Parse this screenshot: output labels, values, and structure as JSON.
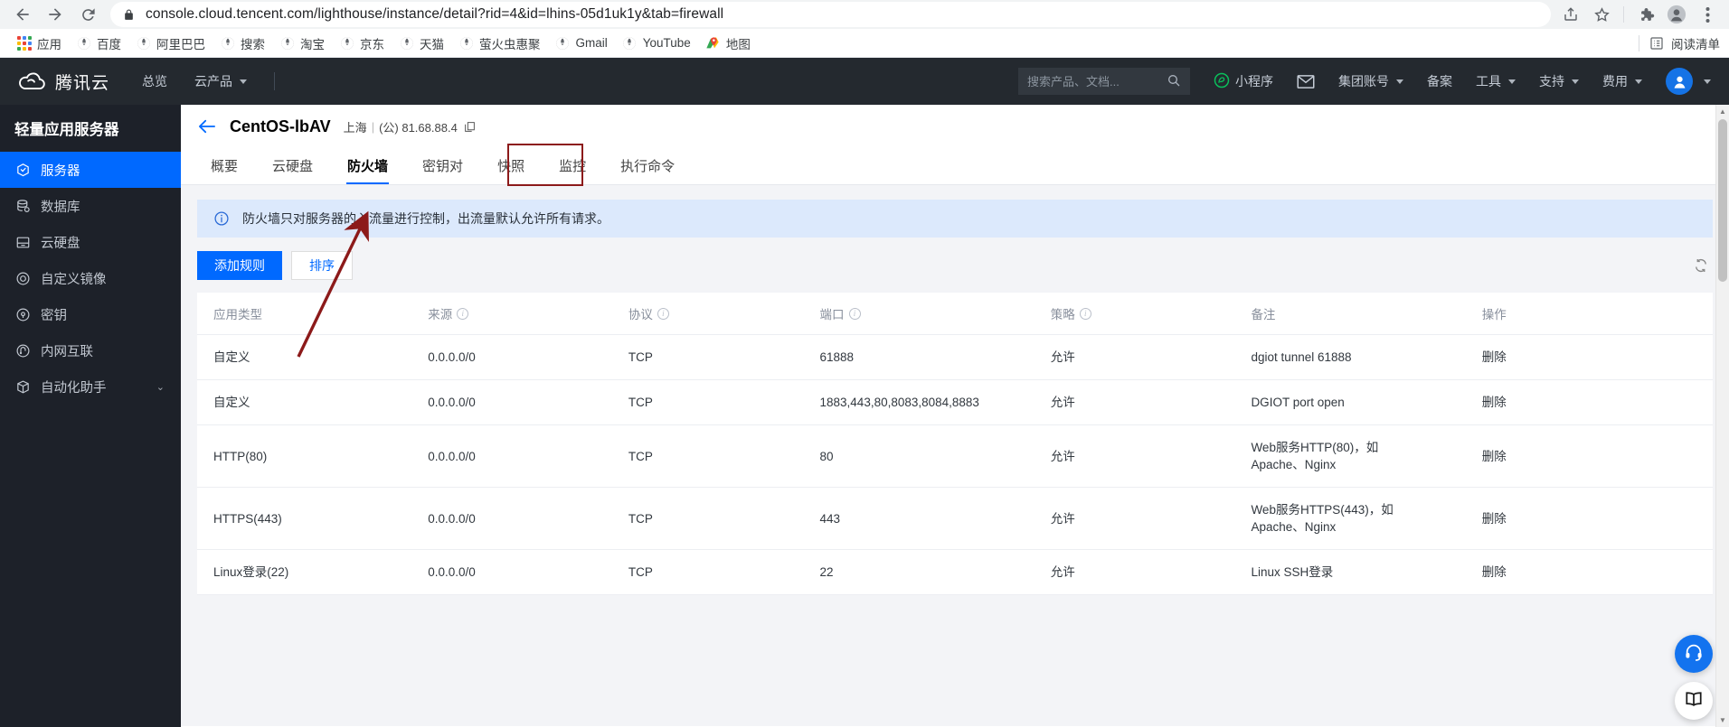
{
  "browser": {
    "url": "console.cloud.tencent.com/lighthouse/instance/detail?rid=4&id=lhins-05d1uk1y&tab=firewall",
    "back_icon": "back-arrow-icon",
    "forward_icon": "forward-arrow-icon",
    "reload_icon": "reload-icon",
    "lock_icon": "lock-icon",
    "share_icon": "share-icon",
    "bookmark_icon": "star-icon",
    "extensions_icon": "puzzle-icon",
    "profile_icon": "person-icon",
    "menu_icon": "three-dot-menu-icon",
    "bookmarks": [
      {
        "label": "应用",
        "icon": "apps-grid-icon"
      },
      {
        "label": "百度",
        "icon": "globe-icon"
      },
      {
        "label": "阿里巴巴",
        "icon": "globe-icon"
      },
      {
        "label": "搜索",
        "icon": "globe-icon"
      },
      {
        "label": "淘宝",
        "icon": "globe-icon"
      },
      {
        "label": "京东",
        "icon": "globe-icon"
      },
      {
        "label": "天猫",
        "icon": "globe-icon"
      },
      {
        "label": "萤火虫惠聚",
        "icon": "globe-icon"
      },
      {
        "label": "Gmail",
        "icon": "globe-icon"
      },
      {
        "label": "YouTube",
        "icon": "globe-icon"
      },
      {
        "label": "地图",
        "icon": "maps-pin-icon"
      }
    ],
    "reading_list": {
      "label": "阅读清单",
      "icon": "reading-list-icon"
    }
  },
  "header": {
    "brand": "腾讯云",
    "logo_icon": "tencent-cloud-logo",
    "nav": [
      {
        "label": "总览",
        "caret": false
      },
      {
        "label": "云产品",
        "caret": true
      }
    ],
    "search": {
      "placeholder": "搜索产品、文档...",
      "value": "",
      "icon": "search-icon"
    },
    "miniprogram": {
      "label": "小程序",
      "icon": "miniprogram-icon"
    },
    "mail_icon": "mail-icon",
    "right_items": [
      {
        "label": "集团账号",
        "caret": true
      },
      {
        "label": "备案",
        "caret": false
      },
      {
        "label": "工具",
        "caret": true
      },
      {
        "label": "支持",
        "caret": true
      },
      {
        "label": "费用",
        "caret": true
      }
    ],
    "avatar_icon": "user-avatar-icon",
    "avatar_caret": true
  },
  "sidebar": {
    "title": "轻量应用服务器",
    "items": [
      {
        "label": "服务器",
        "icon": "server-icon",
        "active": true,
        "chevron": false
      },
      {
        "label": "数据库",
        "icon": "database-icon",
        "active": false,
        "chevron": false
      },
      {
        "label": "云硬盘",
        "icon": "disk-icon",
        "active": false,
        "chevron": false
      },
      {
        "label": "自定义镜像",
        "icon": "image-icon",
        "active": false,
        "chevron": false
      },
      {
        "label": "密钥",
        "icon": "key-icon",
        "active": false,
        "chevron": false
      },
      {
        "label": "内网互联",
        "icon": "network-icon",
        "active": false,
        "chevron": false
      },
      {
        "label": "自动化助手",
        "icon": "assistant-icon",
        "active": false,
        "chevron": true
      }
    ]
  },
  "instance": {
    "back_icon": "back-arrow-icon",
    "name": "CentOS-lbAV",
    "region": "上海",
    "separator": "|",
    "ip_label": "(公) 81.68.88.4",
    "copy_icon": "copy-icon"
  },
  "tabs": [
    {
      "label": "概要",
      "active": false
    },
    {
      "label": "云硬盘",
      "active": false
    },
    {
      "label": "防火墙",
      "active": true,
      "highlighted": true
    },
    {
      "label": "密钥对",
      "active": false
    },
    {
      "label": "快照",
      "active": false
    },
    {
      "label": "监控",
      "active": false
    },
    {
      "label": "执行命令",
      "active": false
    }
  ],
  "notice": {
    "icon": "info-circle-icon",
    "text": "防火墙只对服务器的入流量进行控制，出流量默认允许所有请求。"
  },
  "actions": {
    "add_rule": "添加规则",
    "sort": "排序",
    "refresh_icon": "refresh-icon"
  },
  "table": {
    "columns": [
      {
        "label": "应用类型",
        "info": false
      },
      {
        "label": "来源",
        "info": true
      },
      {
        "label": "协议",
        "info": true
      },
      {
        "label": "端口",
        "info": true
      },
      {
        "label": "策略",
        "info": true
      },
      {
        "label": "备注",
        "info": false
      },
      {
        "label": "操作",
        "info": false
      }
    ],
    "rows": [
      {
        "type": "自定义",
        "source": "0.0.0.0/0",
        "protocol": "TCP",
        "port": "61888",
        "policy": "允许",
        "note": "dgiot tunnel 61888",
        "action": "删除"
      },
      {
        "type": "自定义",
        "source": "0.0.0.0/0",
        "protocol": "TCP",
        "port": "1883,443,80,8083,8084,8883",
        "policy": "允许",
        "note": "DGIOT port open",
        "action": "删除"
      },
      {
        "type": "HTTP(80)",
        "source": "0.0.0.0/0",
        "protocol": "TCP",
        "port": "80",
        "policy": "允许",
        "note": "Web服务HTTP(80)，如\nApache、Nginx",
        "action": "删除"
      },
      {
        "type": "HTTPS(443)",
        "source": "0.0.0.0/0",
        "protocol": "TCP",
        "port": "443",
        "policy": "允许",
        "note": "Web服务HTTPS(443)，如\nApache、Nginx",
        "action": "删除"
      },
      {
        "type": "Linux登录(22)",
        "source": "0.0.0.0/0",
        "protocol": "TCP",
        "port": "22",
        "policy": "允许",
        "note": "Linux SSH登录",
        "action": "删除"
      }
    ]
  },
  "floating": {
    "support_icon": "headset-icon",
    "docs_icon": "book-icon"
  },
  "colors": {
    "accent": "#0069ff",
    "allow": "#23a14b",
    "link": "#2a6ad6",
    "header_bg": "#24292f",
    "sidebar_bg": "#1d2129",
    "annotation": "#8c1a1a"
  }
}
